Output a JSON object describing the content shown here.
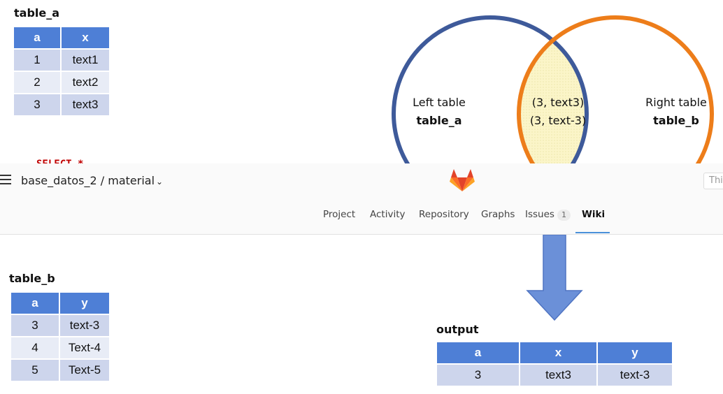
{
  "table_a": {
    "caption": "table_a",
    "headers": [
      "a",
      "x"
    ],
    "rows": [
      [
        "1",
        "text1"
      ],
      [
        "2",
        "text2"
      ],
      [
        "3",
        "text3"
      ]
    ]
  },
  "venn": {
    "left_label": "Left table",
    "left_name": "table_a",
    "right_label": "Right table",
    "right_name": "table_b",
    "intersection": [
      "(3, text3)",
      "(3, text-3)"
    ],
    "left_color": "#3e5a9a",
    "right_color": "#ed7d1a",
    "overlap_fill": "#fbf5c8"
  },
  "sql_snippet": "SELECT *",
  "gitlab": {
    "project_path": "base_datos_2 / material",
    "search_placeholder": "Thi",
    "nav": [
      "Project",
      "Activity",
      "Repository",
      "Graphs",
      "Issues",
      "Wiki"
    ],
    "issues_count": "1",
    "active_tab": "Wiki",
    "accent": "#4a90d9"
  },
  "table_b": {
    "caption": "table_b",
    "headers": [
      "a",
      "y"
    ],
    "rows": [
      [
        "3",
        "text-3"
      ],
      [
        "4",
        "Text-4"
      ],
      [
        "5",
        "Text-5"
      ]
    ]
  },
  "output": {
    "caption": "output",
    "headers": [
      "a",
      "x",
      "y"
    ],
    "rows": [
      [
        "3",
        "text3",
        "text-3"
      ]
    ]
  },
  "colors": {
    "header_blue": "#4e7fd6",
    "row_light": "#cdd5ec",
    "row_lighter": "#e8ecf6",
    "arrow": "#6b90d8"
  }
}
